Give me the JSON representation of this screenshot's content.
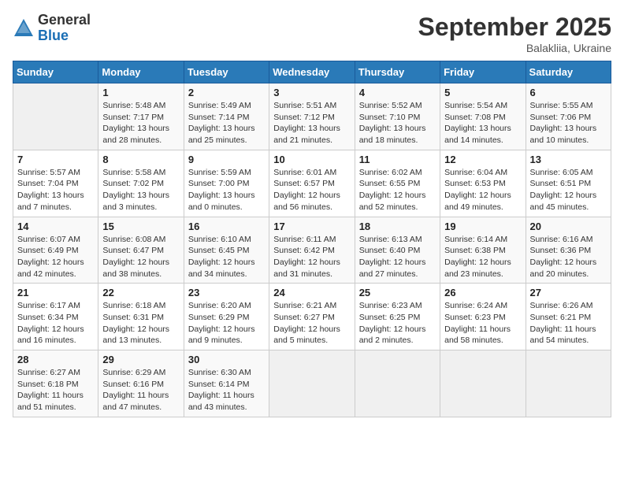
{
  "header": {
    "logo_general": "General",
    "logo_blue": "Blue",
    "month_title": "September 2025",
    "subtitle": "Balakliia, Ukraine"
  },
  "days_of_week": [
    "Sunday",
    "Monday",
    "Tuesday",
    "Wednesday",
    "Thursday",
    "Friday",
    "Saturday"
  ],
  "weeks": [
    [
      null,
      {
        "day": 1,
        "sunrise": "5:48 AM",
        "sunset": "7:17 PM",
        "daylight": "13 hours and 28 minutes."
      },
      {
        "day": 2,
        "sunrise": "5:49 AM",
        "sunset": "7:14 PM",
        "daylight": "13 hours and 25 minutes."
      },
      {
        "day": 3,
        "sunrise": "5:51 AM",
        "sunset": "7:12 PM",
        "daylight": "13 hours and 21 minutes."
      },
      {
        "day": 4,
        "sunrise": "5:52 AM",
        "sunset": "7:10 PM",
        "daylight": "13 hours and 18 minutes."
      },
      {
        "day": 5,
        "sunrise": "5:54 AM",
        "sunset": "7:08 PM",
        "daylight": "13 hours and 14 minutes."
      },
      {
        "day": 6,
        "sunrise": "5:55 AM",
        "sunset": "7:06 PM",
        "daylight": "13 hours and 10 minutes."
      }
    ],
    [
      {
        "day": 7,
        "sunrise": "5:57 AM",
        "sunset": "7:04 PM",
        "daylight": "13 hours and 7 minutes."
      },
      {
        "day": 8,
        "sunrise": "5:58 AM",
        "sunset": "7:02 PM",
        "daylight": "13 hours and 3 minutes."
      },
      {
        "day": 9,
        "sunrise": "5:59 AM",
        "sunset": "7:00 PM",
        "daylight": "13 hours and 0 minutes."
      },
      {
        "day": 10,
        "sunrise": "6:01 AM",
        "sunset": "6:57 PM",
        "daylight": "12 hours and 56 minutes."
      },
      {
        "day": 11,
        "sunrise": "6:02 AM",
        "sunset": "6:55 PM",
        "daylight": "12 hours and 52 minutes."
      },
      {
        "day": 12,
        "sunrise": "6:04 AM",
        "sunset": "6:53 PM",
        "daylight": "12 hours and 49 minutes."
      },
      {
        "day": 13,
        "sunrise": "6:05 AM",
        "sunset": "6:51 PM",
        "daylight": "12 hours and 45 minutes."
      }
    ],
    [
      {
        "day": 14,
        "sunrise": "6:07 AM",
        "sunset": "6:49 PM",
        "daylight": "12 hours and 42 minutes."
      },
      {
        "day": 15,
        "sunrise": "6:08 AM",
        "sunset": "6:47 PM",
        "daylight": "12 hours and 38 minutes."
      },
      {
        "day": 16,
        "sunrise": "6:10 AM",
        "sunset": "6:45 PM",
        "daylight": "12 hours and 34 minutes."
      },
      {
        "day": 17,
        "sunrise": "6:11 AM",
        "sunset": "6:42 PM",
        "daylight": "12 hours and 31 minutes."
      },
      {
        "day": 18,
        "sunrise": "6:13 AM",
        "sunset": "6:40 PM",
        "daylight": "12 hours and 27 minutes."
      },
      {
        "day": 19,
        "sunrise": "6:14 AM",
        "sunset": "6:38 PM",
        "daylight": "12 hours and 23 minutes."
      },
      {
        "day": 20,
        "sunrise": "6:16 AM",
        "sunset": "6:36 PM",
        "daylight": "12 hours and 20 minutes."
      }
    ],
    [
      {
        "day": 21,
        "sunrise": "6:17 AM",
        "sunset": "6:34 PM",
        "daylight": "12 hours and 16 minutes."
      },
      {
        "day": 22,
        "sunrise": "6:18 AM",
        "sunset": "6:31 PM",
        "daylight": "12 hours and 13 minutes."
      },
      {
        "day": 23,
        "sunrise": "6:20 AM",
        "sunset": "6:29 PM",
        "daylight": "12 hours and 9 minutes."
      },
      {
        "day": 24,
        "sunrise": "6:21 AM",
        "sunset": "6:27 PM",
        "daylight": "12 hours and 5 minutes."
      },
      {
        "day": 25,
        "sunrise": "6:23 AM",
        "sunset": "6:25 PM",
        "daylight": "12 hours and 2 minutes."
      },
      {
        "day": 26,
        "sunrise": "6:24 AM",
        "sunset": "6:23 PM",
        "daylight": "11 hours and 58 minutes."
      },
      {
        "day": 27,
        "sunrise": "6:26 AM",
        "sunset": "6:21 PM",
        "daylight": "11 hours and 54 minutes."
      }
    ],
    [
      {
        "day": 28,
        "sunrise": "6:27 AM",
        "sunset": "6:18 PM",
        "daylight": "11 hours and 51 minutes."
      },
      {
        "day": 29,
        "sunrise": "6:29 AM",
        "sunset": "6:16 PM",
        "daylight": "11 hours and 47 minutes."
      },
      {
        "day": 30,
        "sunrise": "6:30 AM",
        "sunset": "6:14 PM",
        "daylight": "11 hours and 43 minutes."
      },
      null,
      null,
      null,
      null
    ]
  ]
}
